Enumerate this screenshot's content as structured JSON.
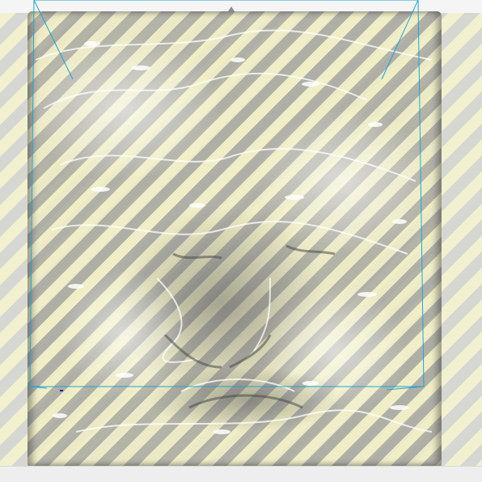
{
  "viewer": {
    "background_colors": {
      "stripe_light": "#f2f1cf",
      "stripe_dark": "#d6d6d2",
      "frame_line": "#1fa5cf",
      "gizmo_dot": "#1a2a9a",
      "mesh_shadow": "#6e6e6e",
      "mesh_highlight": "#ffffff"
    },
    "mesh": {
      "description_icon": "relief-mesh-icon"
    },
    "selection_frame": {
      "icon": "bounding-box-icon"
    },
    "top_handle": {
      "icon": "drag-handle-icon"
    }
  }
}
